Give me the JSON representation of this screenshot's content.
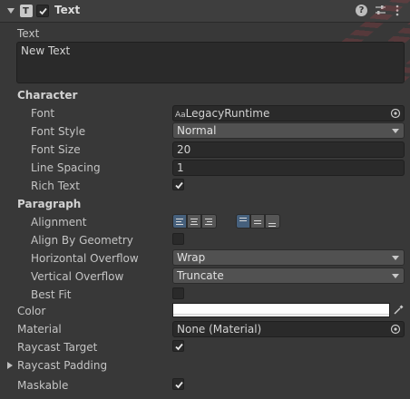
{
  "component": {
    "title": "Text",
    "icons": [
      "help-icon",
      "presets-icon",
      "more-icon"
    ]
  },
  "text_field": {
    "label": "Text",
    "value": "New Text"
  },
  "character": {
    "header": "Character",
    "font": {
      "label": "Font",
      "icon": "Aa",
      "value": "LegacyRuntime"
    },
    "font_style": {
      "label": "Font Style",
      "value": "Normal"
    },
    "font_size": {
      "label": "Font Size",
      "value": "20"
    },
    "line_spacing": {
      "label": "Line Spacing",
      "value": "1"
    },
    "rich_text": {
      "label": "Rich Text",
      "checked": true
    }
  },
  "paragraph": {
    "header": "Paragraph",
    "alignment": {
      "label": "Alignment",
      "horizontal": "left",
      "vertical": "top"
    },
    "align_by_geometry": {
      "label": "Align By Geometry",
      "checked": false
    },
    "horizontal_overflow": {
      "label": "Horizontal Overflow",
      "value": "Wrap"
    },
    "vertical_overflow": {
      "label": "Vertical Overflow",
      "value": "Truncate"
    },
    "best_fit": {
      "label": "Best Fit",
      "checked": false
    }
  },
  "color": {
    "label": "Color",
    "value": "#ffffff"
  },
  "material": {
    "label": "Material",
    "value": "None (Material)"
  },
  "raycast_target": {
    "label": "Raycast Target",
    "checked": true
  },
  "raycast_padding": {
    "label": "Raycast Padding"
  },
  "maskable": {
    "label": "Maskable",
    "checked": true
  },
  "colors": {
    "panel": "#383838",
    "field": "#2a2a2a",
    "accent": "#46607c"
  }
}
